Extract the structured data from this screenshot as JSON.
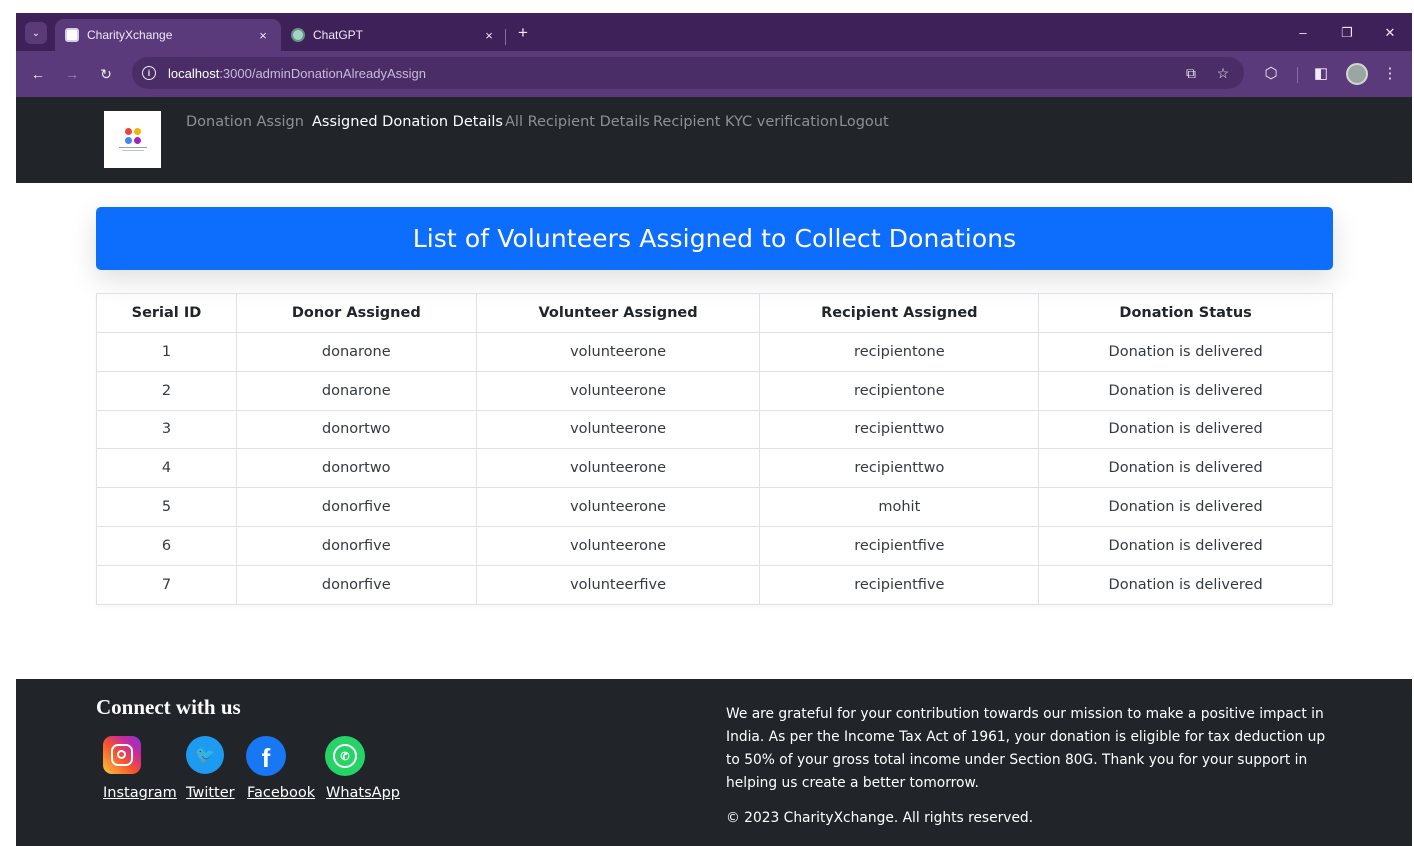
{
  "browser": {
    "tabs": [
      {
        "title": "CharityXchange",
        "close": "×"
      },
      {
        "title": "ChatGPT",
        "close": "×"
      }
    ],
    "new_tab": "+",
    "url_host": "localhost",
    "url_path": ":3000/adminDonationAlreadyAssign",
    "window_controls": {
      "minimize": "–",
      "restore": "❐",
      "close": "✕"
    }
  },
  "navbar": {
    "links": [
      "Donation Assign",
      "Assigned Donation Details",
      "All Recipient Details",
      "Recipient KYC verification",
      "Logout"
    ],
    "active_link": "Assigned Donation Details"
  },
  "page": {
    "title": "List of Volunteers Assigned to Collect Donations"
  },
  "table": {
    "headers": [
      "Serial ID",
      "Donor Assigned",
      "Volunteer Assigned",
      "Recipient Assigned",
      "Donation Status"
    ],
    "rows": [
      [
        "1",
        "donarone",
        "volunteerone",
        "recipientone",
        "Donation is delivered"
      ],
      [
        "2",
        "donarone",
        "volunteerone",
        "recipientone",
        "Donation is delivered"
      ],
      [
        "3",
        "donortwo",
        "volunteerone",
        "recipienttwo",
        "Donation is delivered"
      ],
      [
        "4",
        "donortwo",
        "volunteerone",
        "recipienttwo",
        "Donation is delivered"
      ],
      [
        "5",
        "donorfive",
        "volunteerone",
        "mohit",
        "Donation is delivered"
      ],
      [
        "6",
        "donorfive",
        "volunteerone",
        "recipientfive",
        "Donation is delivered"
      ],
      [
        "7",
        "donorfive",
        "volunteerfive",
        "recipientfive",
        "Donation is delivered"
      ]
    ]
  },
  "footer": {
    "heading": "Connect with us",
    "social": [
      {
        "name": "Instagram",
        "icon": "instagram-icon"
      },
      {
        "name": "Twitter",
        "icon": "twitter-icon"
      },
      {
        "name": "Facebook",
        "icon": "facebook-icon"
      },
      {
        "name": "WhatsApp",
        "icon": "whatsapp-icon"
      }
    ],
    "message": "We are grateful for your contribution towards our mission to make a positive impact in India. As per the Income Tax Act of 1961, your donation is eligible for tax deduction up to 50% of your gross total income under Section 80G. Thank you for your support in helping us create a better tomorrow.",
    "copyright": "© 2023 CharityXchange. All rights reserved."
  },
  "colors": {
    "browser_frame": "#3f2159",
    "browser_toolbar": "#5b3a7c",
    "navbar_bg": "#212529",
    "banner_bg": "#0d6efd",
    "footer_bg": "#212529"
  }
}
